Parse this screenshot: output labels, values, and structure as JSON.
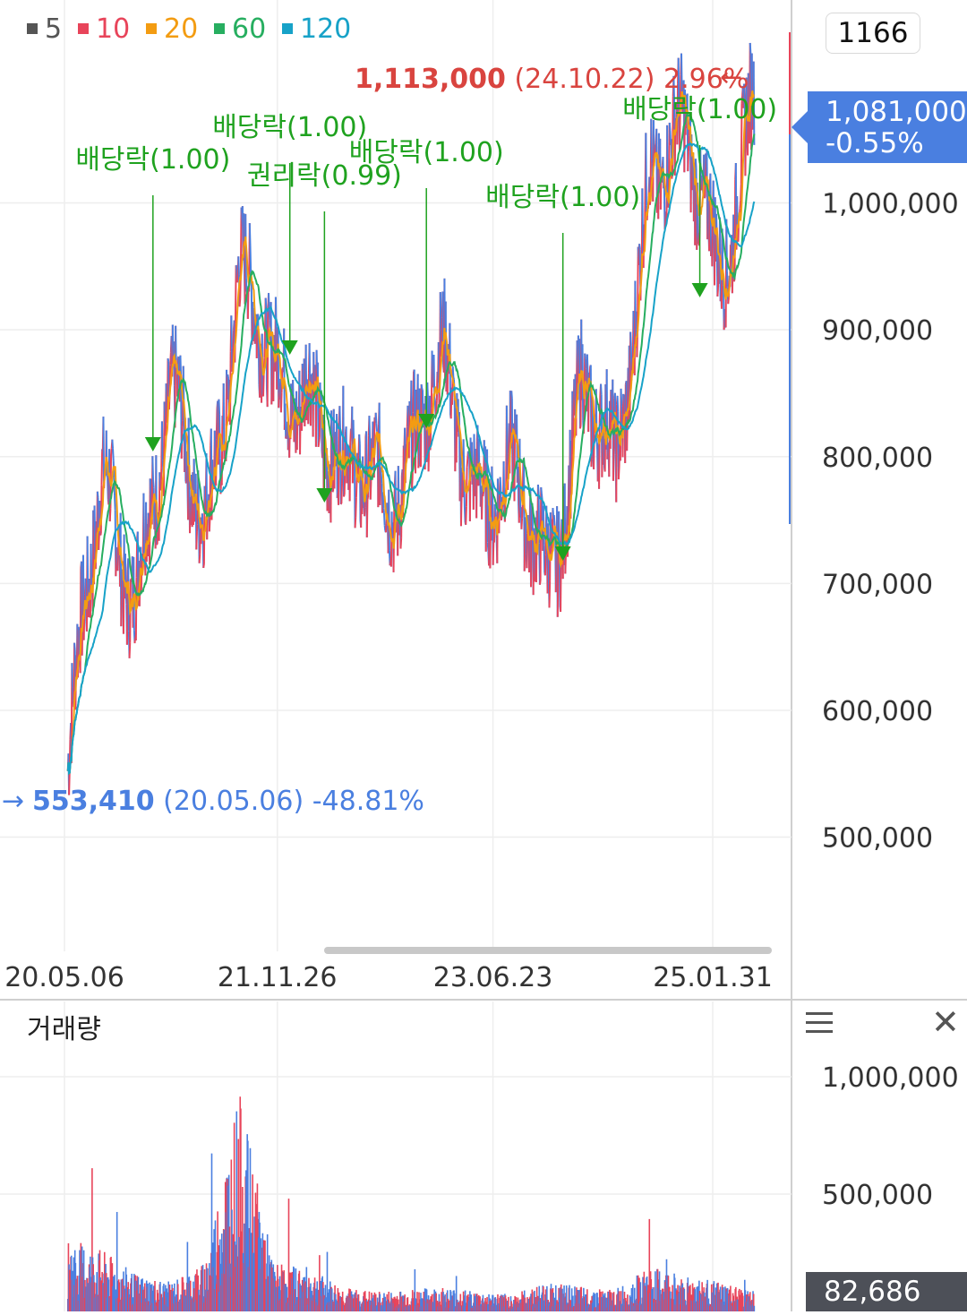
{
  "toolbar": {
    "ma_legend": [
      {
        "label": "5",
        "color": "#555555"
      },
      {
        "label": "10",
        "color": "#e8445a"
      },
      {
        "label": "20",
        "color": "#f39c12"
      },
      {
        "label": "60",
        "color": "#27ae60"
      },
      {
        "label": "120",
        "color": "#17a2c8"
      }
    ],
    "count_label": "1166"
  },
  "price_panel": {
    "current_price": "1,081,000",
    "current_change": "-0.55%",
    "max_value": "1,113,000",
    "max_detail": "(24.10.22) 2.96%",
    "min_value": "553,410",
    "min_detail": "(20.05.06) -48.81%",
    "events": [
      {
        "label": "배당락(1.00)",
        "date": "20.12.29"
      },
      {
        "label": "배당락(1.00)",
        "date": "21.12.29"
      },
      {
        "label": "권리락(0.99)",
        "date": "22.03.30"
      },
      {
        "label": "배당락(1.00)",
        "date": "22.12.28"
      },
      {
        "label": "배당락(1.00)",
        "date": "23.12.27"
      },
      {
        "label": "배당락(1.00)",
        "date": "24.12.27"
      }
    ]
  },
  "volume_panel": {
    "title": "거래량",
    "current_volume": "82,686"
  },
  "colors": {
    "up": "#e8445a",
    "down": "#4a7fe0",
    "event": "#1fa21f",
    "price_badge": "#4a7fe0",
    "max_label": "#d9443f",
    "min_label": "#4a7fe0"
  },
  "chart_data": [
    {
      "type": "line",
      "title": "",
      "x_ticks": [
        "20.05.06",
        "21.11.26",
        "23.06.23",
        "25.01.31"
      ],
      "y_ticks": [
        "1,000,000",
        "900,000",
        "800,000",
        "700,000",
        "600,000",
        "500,000"
      ],
      "ylim": [
        410000,
        1160000
      ],
      "series": [
        {
          "name": "5",
          "values": []
        },
        {
          "name": "10",
          "values": []
        },
        {
          "name": "20",
          "values": []
        },
        {
          "name": "60",
          "values": []
        },
        {
          "name": "120",
          "values": []
        }
      ],
      "x": [
        "20.05",
        "20.08",
        "20.11",
        "21.02",
        "21.05",
        "21.08",
        "21.11",
        "22.02",
        "22.05",
        "22.08",
        "22.11",
        "23.02",
        "23.05",
        "23.08",
        "23.11",
        "24.02",
        "24.05",
        "24.08",
        "24.11",
        "25.02",
        "25.05"
      ],
      "price": [
        553000,
        770000,
        720000,
        820000,
        760000,
        940000,
        850000,
        880000,
        760000,
        800000,
        790000,
        860000,
        790000,
        760000,
        720000,
        850000,
        770000,
        1050000,
        1030000,
        960000,
        1081000
      ],
      "grid": true
    },
    {
      "type": "bar",
      "title": "거래량",
      "y_ticks": [
        "1,000,000",
        "500,000"
      ],
      "ylim": [
        0,
        1200000
      ],
      "x": [
        "20.05",
        "20.08",
        "20.11",
        "21.02",
        "21.05",
        "21.08",
        "21.11",
        "22.02",
        "22.05",
        "22.08",
        "22.11",
        "23.02",
        "23.05",
        "23.08",
        "23.11",
        "24.02",
        "24.05",
        "24.08",
        "24.11",
        "25.02",
        "25.05"
      ],
      "values": [
        300000,
        250000,
        150000,
        120000,
        200000,
        900000,
        200000,
        180000,
        100000,
        80000,
        90000,
        100000,
        80000,
        70000,
        120000,
        100000,
        90000,
        180000,
        150000,
        120000,
        82686
      ],
      "grid": true
    }
  ]
}
